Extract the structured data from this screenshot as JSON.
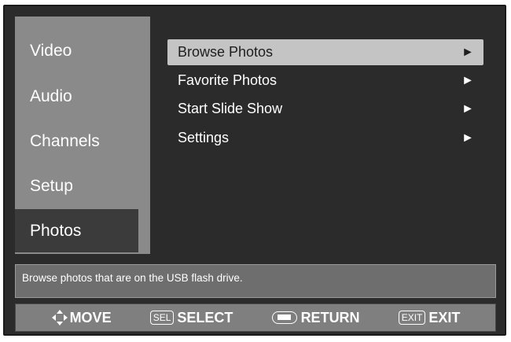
{
  "sidebar": {
    "items": [
      {
        "label": "Video"
      },
      {
        "label": "Audio"
      },
      {
        "label": "Channels"
      },
      {
        "label": "Setup"
      },
      {
        "label": "Photos",
        "active": true
      }
    ]
  },
  "menu": {
    "items": [
      {
        "label": "Browse Photos",
        "arrow": "►",
        "selected": true
      },
      {
        "label": "Favorite Photos",
        "arrow": "►"
      },
      {
        "label": "Start Slide Show",
        "arrow": "►"
      },
      {
        "label": "Settings",
        "arrow": "►"
      }
    ]
  },
  "description": "Browse photos that are on the USB flash drive.",
  "footer": {
    "move": {
      "icon": "dpad-arrows-icon",
      "label": "MOVE"
    },
    "select": {
      "key": "SEL",
      "label": "SELECT"
    },
    "return": {
      "icon": "return-key-icon",
      "label": "RETURN"
    },
    "exit": {
      "key": "EXIT",
      "label": "EXIT"
    }
  },
  "colors": {
    "frame": "#2b2b2b",
    "sidebar": "#8a8a8a",
    "active_sidebar": "#3b3b3b",
    "selected_item": "#c4c4c4",
    "footer": "#7f7f7f"
  }
}
